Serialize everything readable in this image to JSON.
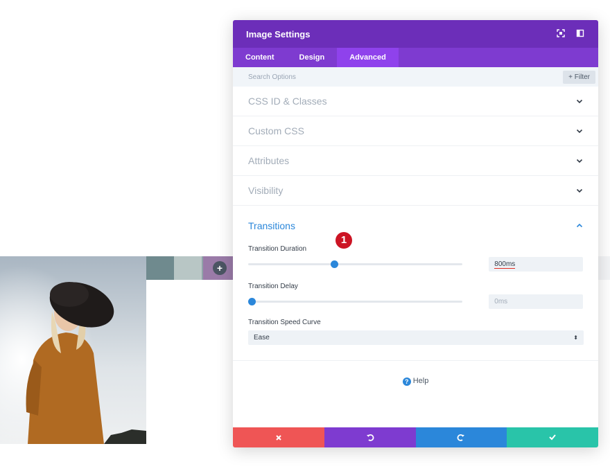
{
  "modal": {
    "title": "Image Settings",
    "tabs": [
      {
        "label": "Content"
      },
      {
        "label": "Design"
      },
      {
        "label": "Advanced",
        "active": true
      }
    ],
    "search": {
      "placeholder": "Search Options",
      "filter_label": "+ Filter"
    },
    "sections": [
      {
        "label": "CSS ID & Classes"
      },
      {
        "label": "Custom CSS"
      },
      {
        "label": "Attributes"
      },
      {
        "label": "Visibility"
      }
    ],
    "transitions": {
      "label": "Transitions",
      "duration": {
        "label": "Transition Duration",
        "value": "800ms",
        "slider_fraction": 0.4
      },
      "delay": {
        "label": "Transition Delay",
        "value": "0ms",
        "slider_fraction": 0.0
      },
      "curve": {
        "label": "Transition Speed Curve",
        "value": "Ease"
      }
    },
    "help_label": "Help",
    "annotation_badge": "1"
  },
  "colors": {
    "header": "#6c2eb9",
    "tabs": "#7e3bd0",
    "accent": "#2b87da",
    "cancel": "#ef5555",
    "save": "#29c4a9"
  },
  "icons": {
    "header": [
      "fullscreen-icon",
      "split-view-icon"
    ],
    "footer": [
      "close-icon",
      "undo-icon",
      "redo-icon",
      "check-icon"
    ]
  }
}
